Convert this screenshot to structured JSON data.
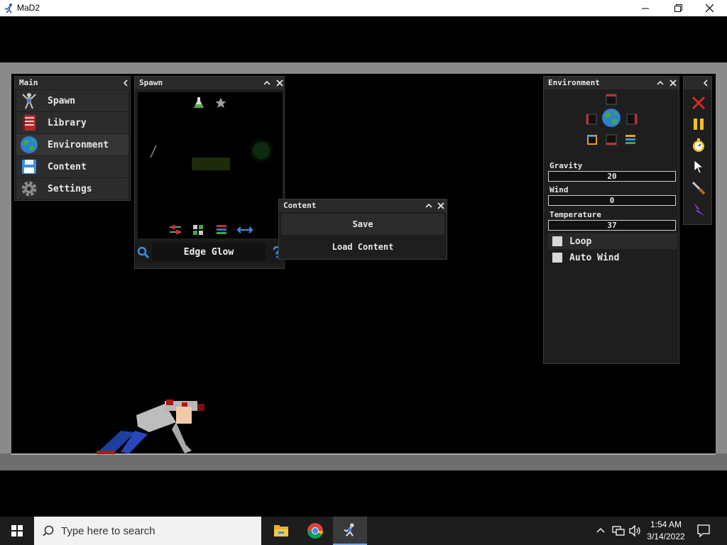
{
  "window": {
    "title": "MaD2"
  },
  "main_menu": {
    "title": "Main",
    "items": [
      {
        "label": "Spawn",
        "icon": "ragdoll-icon"
      },
      {
        "label": "Library",
        "icon": "book-icon"
      },
      {
        "label": "Environment",
        "icon": "globe-icon"
      },
      {
        "label": "Content",
        "icon": "floppy-disk-icon"
      },
      {
        "label": "Settings",
        "icon": "gear-icon"
      }
    ]
  },
  "spawn": {
    "title": "Spawn",
    "search_value": "Edge Glow"
  },
  "content": {
    "title": "Content",
    "buttons": [
      "Save",
      "Load Content"
    ]
  },
  "environment": {
    "title": "Environment",
    "fields": [
      {
        "label": "Gravity",
        "value": "20"
      },
      {
        "label": "Wind",
        "value": "0"
      },
      {
        "label": "Temperature",
        "value": "37"
      }
    ],
    "checks": [
      {
        "label": "Loop",
        "checked": false
      },
      {
        "label": "Auto Wind",
        "checked": false
      }
    ]
  },
  "taskbar": {
    "search_placeholder": "Type here to search",
    "time": "1:54 AM",
    "date": "3/14/2022"
  },
  "colors": {
    "panel": "#1e1e1e",
    "header": "#2a2a2a",
    "frame": "#8a8a8a",
    "taskbar": "#1d1d1d",
    "accent_blue": "#3a8ee6"
  }
}
